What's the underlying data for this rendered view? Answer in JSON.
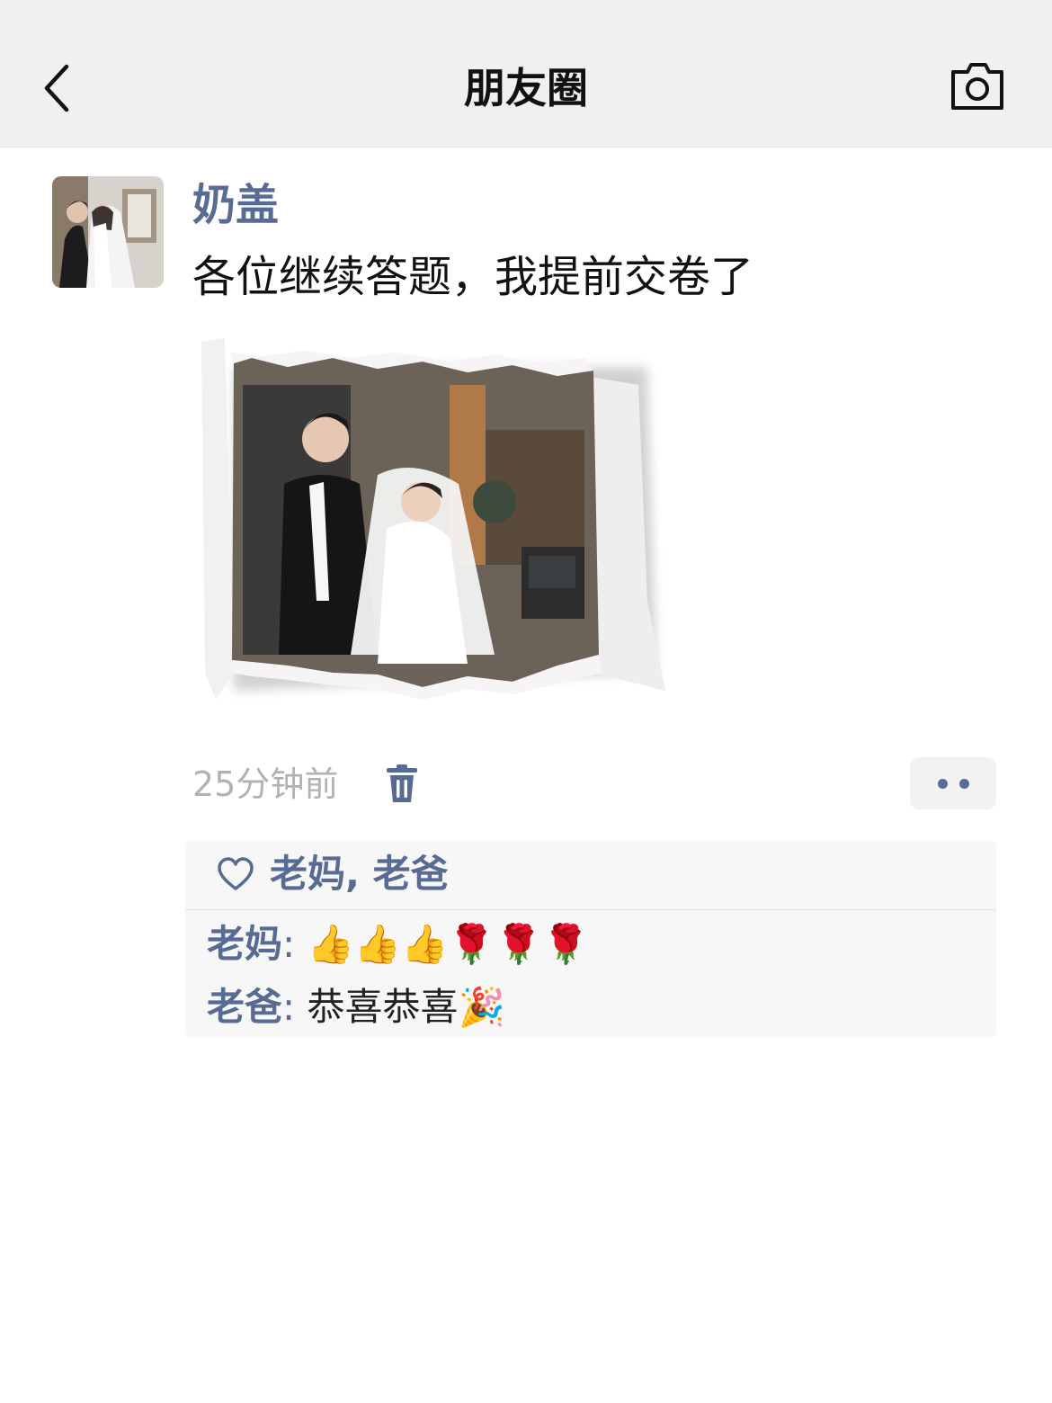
{
  "header": {
    "title": "朋友圈",
    "back_icon": "chevron-left-icon",
    "camera_icon": "camera-icon"
  },
  "post": {
    "author": "奶盖",
    "text": "各位继续答题，我提前交卷了",
    "time": "25分钟前",
    "delete_icon": "trash-icon",
    "more_icon": "more-dots-icon"
  },
  "likes": {
    "icon": "heart-icon",
    "names": "老妈, 老爸"
  },
  "comments": [
    {
      "author": "老妈",
      "colon": ":",
      "text": " 👍👍👍🌹🌹🌹"
    },
    {
      "author": "老爸",
      "colon": ":",
      "text": " 恭喜恭喜🎉"
    }
  ],
  "colors": {
    "link": "#576b95",
    "header_bg": "#f0f0f0",
    "timestamp": "#b2b2b2"
  }
}
